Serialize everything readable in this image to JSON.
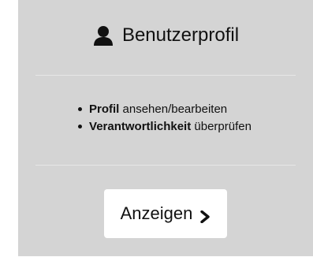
{
  "card": {
    "title": "Benutzerprofil",
    "title_icon": "user-icon",
    "features": [
      {
        "bold": "Profil",
        "text": " ansehen/bearbeiten"
      },
      {
        "bold": "Verantwortlichkeit",
        "text": " überprüfen"
      }
    ],
    "button": {
      "label": "Anzeigen",
      "icon": "chevron-right-icon"
    }
  },
  "colors": {
    "card_background": "#d4d4d4",
    "button_background": "#ffffff",
    "text": "#111111",
    "divider": "#e6e6e6"
  }
}
